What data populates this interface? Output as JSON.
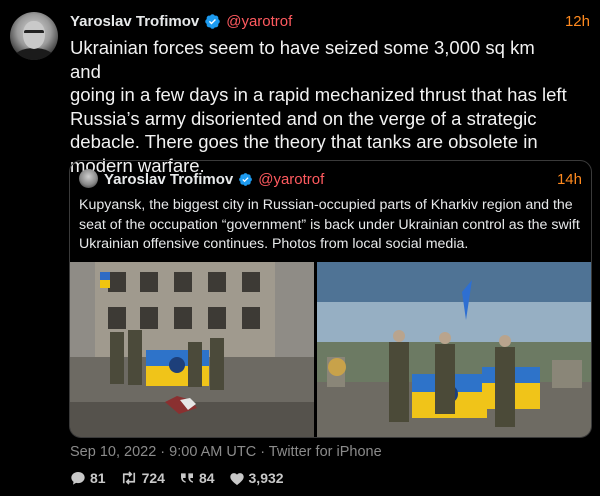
{
  "tweet": {
    "author_name": "Yaroslav Trofimov",
    "handle": "@yarotrof",
    "time": "12h",
    "text": "Ukrainian forces seem to have seized some 3,000 sq km and\ngoing in a few days in a rapid mechanized thrust that has left\nRussia’s army disoriented and on the verge of a strategic\ndebacle. There goes the theory that tanks are obsolete in\nmodern warfare.",
    "timestamp": "Sep 10, 2022 · 9:00 AM UTC · Twitter for iPhone"
  },
  "quote": {
    "author_name": "Yaroslav Trofimov",
    "handle": "@yarotrof",
    "time": "14h",
    "text": "Kupyansk, the biggest city in Russian-occupied parts of Kharkiv region and the seat of the occupation “government” is back under Ukrainian control as the swift Ukrainian offensive continues. Photos from local social media."
  },
  "stats": {
    "replies": "81",
    "retweets": "724",
    "quotes": "84",
    "likes": "3,932"
  },
  "colors": {
    "handle": "#ff5a5f",
    "time": "#ff8a1f",
    "verified": "#1d9bf0"
  },
  "icons": {
    "reply": "comment-icon",
    "retweet": "retweet-icon",
    "quote": "quote-icon",
    "like": "heart-icon"
  }
}
